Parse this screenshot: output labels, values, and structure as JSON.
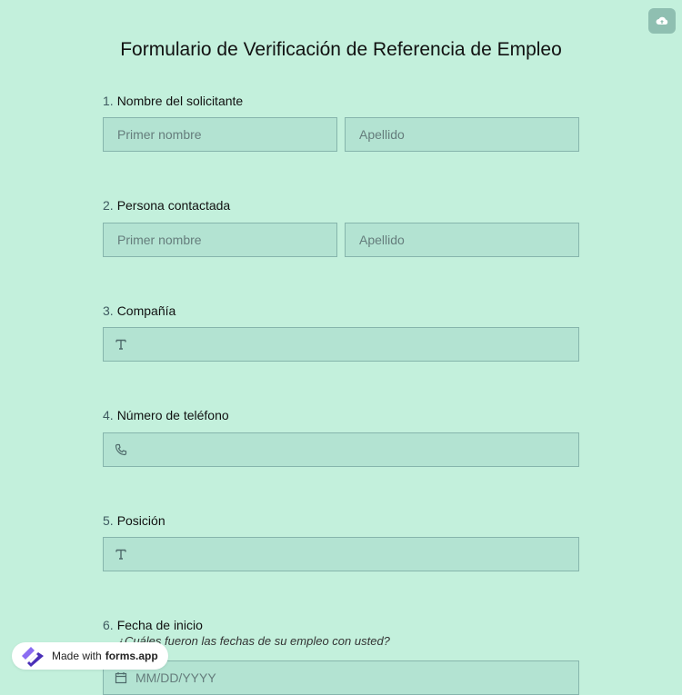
{
  "header": {
    "title": "Formulario de Verificación de Referencia de Empleo",
    "save_icon": "cloud-upload-icon"
  },
  "questions": [
    {
      "number": "1.",
      "label": "Nombre del solicitante",
      "first_placeholder": "Primer nombre",
      "last_placeholder": "Apellido"
    },
    {
      "number": "2.",
      "label": "Persona contactada",
      "first_placeholder": "Primer nombre",
      "last_placeholder": "Apellido"
    },
    {
      "number": "3.",
      "label": "Compañía",
      "icon": "text-icon"
    },
    {
      "number": "4.",
      "label": "Número de teléfono",
      "icon": "phone-icon"
    },
    {
      "number": "5.",
      "label": "Posición",
      "icon": "text-icon"
    },
    {
      "number": "6.",
      "label": "Fecha de inicio",
      "subtitle": "¿Cuáles fueron las fechas de su empleo con usted?",
      "placeholder": "MM/DD/YYYY",
      "icon": "calendar-icon"
    }
  ],
  "badge": {
    "prefix": "Made with",
    "brand": "forms.app",
    "icon": "forms-app-logo-icon"
  },
  "colors": {
    "background": "#c3f0dc",
    "field_bg": "#b3e3d2",
    "field_border": "#86b5ac",
    "accent_button": "#8fbfb1"
  }
}
